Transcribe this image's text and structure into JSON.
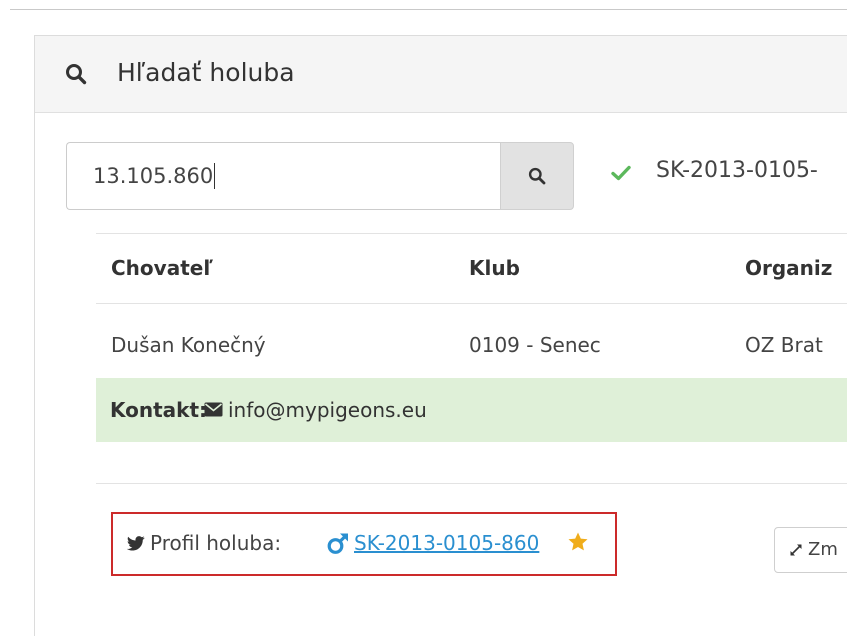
{
  "panel": {
    "title": "Hľadať holuba"
  },
  "search": {
    "value": "13.105.860",
    "status_text": "SK-2013-0105-"
  },
  "table": {
    "headers": [
      "Chovateľ",
      "Klub",
      "Organiz"
    ],
    "row": [
      "Dušan Konečný",
      "0109 - Senec",
      "OZ Brat"
    ]
  },
  "contact": {
    "label": "Kontakt:",
    "email": "info@mypigeons.eu"
  },
  "profile": {
    "label": "Profil holuba:",
    "ring": "SK-2013-0105-860"
  },
  "expand_button": {
    "label": "Zm"
  },
  "colors": {
    "accent_link": "#2a8fd0",
    "success_check": "#5cb85c",
    "contact_bg": "#dff0d8",
    "highlight_border": "#cc2a2a",
    "star": "#f0ad1b"
  },
  "icons": {
    "heading": "search-icon",
    "search_button": "search-icon",
    "status": "check-icon",
    "contact": "envelope-icon",
    "profile": "twitter-icon",
    "gender": "male-icon",
    "favorite": "star-icon",
    "expand": "expand-icon"
  }
}
